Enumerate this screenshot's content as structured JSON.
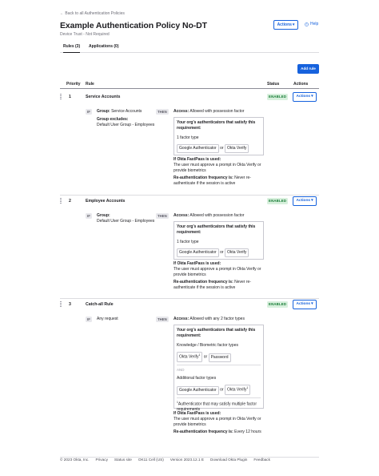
{
  "back_link": "← Back to all Authentication Policies",
  "title": "Example Authentication Policy No-DT",
  "subtitle": "Device Trust - Not Required",
  "header_actions": "Actions",
  "help": "Help",
  "tabs": [
    "Rules (3)",
    "Applications (0)"
  ],
  "add_rule": "Add rule",
  "columns": {
    "priority": "Priority",
    "rule": "Rule",
    "status": "Status",
    "actions": "Actions"
  },
  "if_label": "IF",
  "then_label": "THEN",
  "row_actions": "Actions",
  "common": {
    "access_label": "Access:",
    "req_label": "Your org's authenticators that satisfy this requirement:",
    "one_factor": "1 factor type",
    "google": "Google Authenticator",
    "or": "or",
    "okta_verify": "Okta Verify",
    "fastpass_label": "If Okta FastPass is used:",
    "fastpass_text": "The user must approve a prompt in Okta Verify or provide biometrics",
    "reauth_label": "Re-authentication frequency is:",
    "reauth_never": "Never re-authenticate if the session is active"
  },
  "rules": [
    {
      "priority": "1",
      "name": "Service Accounts",
      "status": "ENABLED",
      "group_label": "Group:",
      "group_value": "Service Accounts",
      "excludes_label": "Group excludes:",
      "excludes_value": "Default User Group - Employees",
      "access": "Allowed with possession factor"
    },
    {
      "priority": "2",
      "name": "Employee Accounts",
      "status": "ENABLED",
      "group_label": "Group:",
      "group_value": "Default User Group - Employees",
      "access": "Allowed with possession factor"
    },
    {
      "priority": "3",
      "name": "Catch-all Rule",
      "status": "ENABLED",
      "condition": "Any request",
      "access": "Allowed with any 2 factor types",
      "knowledge": "Knowledge / Biometric factor types",
      "okta_verify_sup": "Okta Verify",
      "password": "Password",
      "and": "AND",
      "additional": "Additional factor types",
      "footnote": "Authenticator that may satisfy multiple factor requirements",
      "reauth_value": "Every 12 hours"
    }
  ],
  "footer": [
    "© 2023 Okta, Inc.",
    "Privacy",
    "Status site",
    "OK11 Cell (US)",
    "Version 2023.12.1 E",
    "Download Okta Plugin",
    "Feedback"
  ]
}
